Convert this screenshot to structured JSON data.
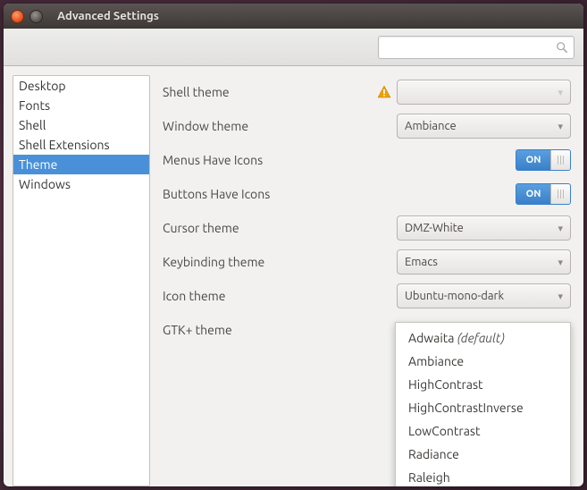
{
  "window": {
    "title": "Advanced Settings"
  },
  "search": {
    "placeholder": ""
  },
  "sidebar": {
    "items": [
      {
        "label": "Desktop"
      },
      {
        "label": "Fonts"
      },
      {
        "label": "Shell"
      },
      {
        "label": "Shell Extensions"
      },
      {
        "label": "Theme",
        "selected": true
      },
      {
        "label": "Windows"
      }
    ]
  },
  "settings": {
    "shell_theme": {
      "label": "Shell theme",
      "value": ""
    },
    "window_theme": {
      "label": "Window theme",
      "value": "Ambiance"
    },
    "menus_have_icons": {
      "label": "Menus Have Icons",
      "value": "ON"
    },
    "buttons_have_icons": {
      "label": "Buttons Have Icons",
      "value": "ON"
    },
    "cursor_theme": {
      "label": "Cursor theme",
      "value": "DMZ-White"
    },
    "keybinding_theme": {
      "label": "Keybinding theme",
      "value": "Emacs"
    },
    "icon_theme": {
      "label": "Icon theme",
      "value": "Ubuntu-mono-dark"
    },
    "gtk_theme": {
      "label": "GTK+ theme"
    }
  },
  "gtk_theme_options": [
    {
      "name": "Adwaita",
      "suffix": "(default)"
    },
    {
      "name": "Ambiance"
    },
    {
      "name": "HighContrast"
    },
    {
      "name": "HighContrastInverse"
    },
    {
      "name": "LowContrast"
    },
    {
      "name": "Radiance"
    },
    {
      "name": "Raleigh"
    }
  ]
}
